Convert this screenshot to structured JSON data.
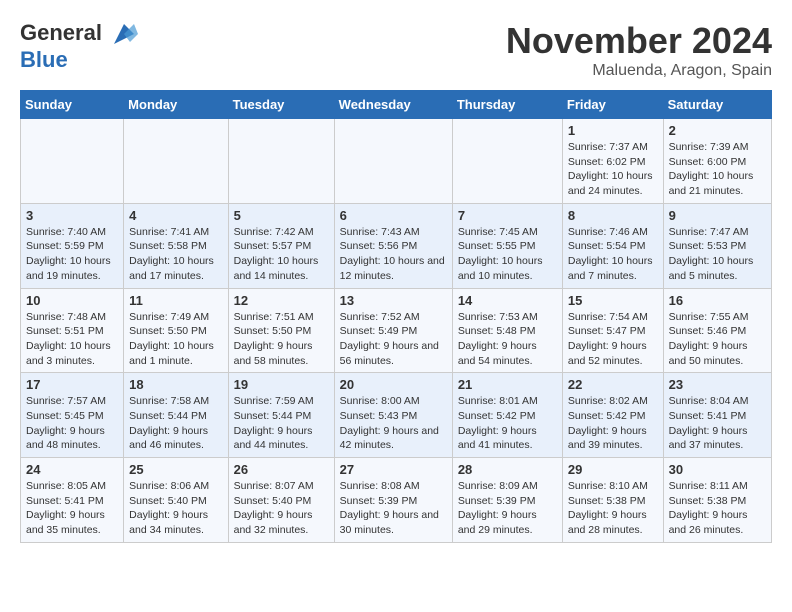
{
  "logo": {
    "line1": "General",
    "line2": "Blue"
  },
  "title": {
    "month": "November 2024",
    "location": "Maluenda, Aragon, Spain"
  },
  "headers": [
    "Sunday",
    "Monday",
    "Tuesday",
    "Wednesday",
    "Thursday",
    "Friday",
    "Saturday"
  ],
  "weeks": [
    [
      {
        "day": "",
        "info": ""
      },
      {
        "day": "",
        "info": ""
      },
      {
        "day": "",
        "info": ""
      },
      {
        "day": "",
        "info": ""
      },
      {
        "day": "",
        "info": ""
      },
      {
        "day": "1",
        "info": "Sunrise: 7:37 AM\nSunset: 6:02 PM\nDaylight: 10 hours and 24 minutes."
      },
      {
        "day": "2",
        "info": "Sunrise: 7:39 AM\nSunset: 6:00 PM\nDaylight: 10 hours and 21 minutes."
      }
    ],
    [
      {
        "day": "3",
        "info": "Sunrise: 7:40 AM\nSunset: 5:59 PM\nDaylight: 10 hours and 19 minutes."
      },
      {
        "day": "4",
        "info": "Sunrise: 7:41 AM\nSunset: 5:58 PM\nDaylight: 10 hours and 17 minutes."
      },
      {
        "day": "5",
        "info": "Sunrise: 7:42 AM\nSunset: 5:57 PM\nDaylight: 10 hours and 14 minutes."
      },
      {
        "day": "6",
        "info": "Sunrise: 7:43 AM\nSunset: 5:56 PM\nDaylight: 10 hours and 12 minutes."
      },
      {
        "day": "7",
        "info": "Sunrise: 7:45 AM\nSunset: 5:55 PM\nDaylight: 10 hours and 10 minutes."
      },
      {
        "day": "8",
        "info": "Sunrise: 7:46 AM\nSunset: 5:54 PM\nDaylight: 10 hours and 7 minutes."
      },
      {
        "day": "9",
        "info": "Sunrise: 7:47 AM\nSunset: 5:53 PM\nDaylight: 10 hours and 5 minutes."
      }
    ],
    [
      {
        "day": "10",
        "info": "Sunrise: 7:48 AM\nSunset: 5:51 PM\nDaylight: 10 hours and 3 minutes."
      },
      {
        "day": "11",
        "info": "Sunrise: 7:49 AM\nSunset: 5:50 PM\nDaylight: 10 hours and 1 minute."
      },
      {
        "day": "12",
        "info": "Sunrise: 7:51 AM\nSunset: 5:50 PM\nDaylight: 9 hours and 58 minutes."
      },
      {
        "day": "13",
        "info": "Sunrise: 7:52 AM\nSunset: 5:49 PM\nDaylight: 9 hours and 56 minutes."
      },
      {
        "day": "14",
        "info": "Sunrise: 7:53 AM\nSunset: 5:48 PM\nDaylight: 9 hours and 54 minutes."
      },
      {
        "day": "15",
        "info": "Sunrise: 7:54 AM\nSunset: 5:47 PM\nDaylight: 9 hours and 52 minutes."
      },
      {
        "day": "16",
        "info": "Sunrise: 7:55 AM\nSunset: 5:46 PM\nDaylight: 9 hours and 50 minutes."
      }
    ],
    [
      {
        "day": "17",
        "info": "Sunrise: 7:57 AM\nSunset: 5:45 PM\nDaylight: 9 hours and 48 minutes."
      },
      {
        "day": "18",
        "info": "Sunrise: 7:58 AM\nSunset: 5:44 PM\nDaylight: 9 hours and 46 minutes."
      },
      {
        "day": "19",
        "info": "Sunrise: 7:59 AM\nSunset: 5:44 PM\nDaylight: 9 hours and 44 minutes."
      },
      {
        "day": "20",
        "info": "Sunrise: 8:00 AM\nSunset: 5:43 PM\nDaylight: 9 hours and 42 minutes."
      },
      {
        "day": "21",
        "info": "Sunrise: 8:01 AM\nSunset: 5:42 PM\nDaylight: 9 hours and 41 minutes."
      },
      {
        "day": "22",
        "info": "Sunrise: 8:02 AM\nSunset: 5:42 PM\nDaylight: 9 hours and 39 minutes."
      },
      {
        "day": "23",
        "info": "Sunrise: 8:04 AM\nSunset: 5:41 PM\nDaylight: 9 hours and 37 minutes."
      }
    ],
    [
      {
        "day": "24",
        "info": "Sunrise: 8:05 AM\nSunset: 5:41 PM\nDaylight: 9 hours and 35 minutes."
      },
      {
        "day": "25",
        "info": "Sunrise: 8:06 AM\nSunset: 5:40 PM\nDaylight: 9 hours and 34 minutes."
      },
      {
        "day": "26",
        "info": "Sunrise: 8:07 AM\nSunset: 5:40 PM\nDaylight: 9 hours and 32 minutes."
      },
      {
        "day": "27",
        "info": "Sunrise: 8:08 AM\nSunset: 5:39 PM\nDaylight: 9 hours and 30 minutes."
      },
      {
        "day": "28",
        "info": "Sunrise: 8:09 AM\nSunset: 5:39 PM\nDaylight: 9 hours and 29 minutes."
      },
      {
        "day": "29",
        "info": "Sunrise: 8:10 AM\nSunset: 5:38 PM\nDaylight: 9 hours and 28 minutes."
      },
      {
        "day": "30",
        "info": "Sunrise: 8:11 AM\nSunset: 5:38 PM\nDaylight: 9 hours and 26 minutes."
      }
    ]
  ]
}
